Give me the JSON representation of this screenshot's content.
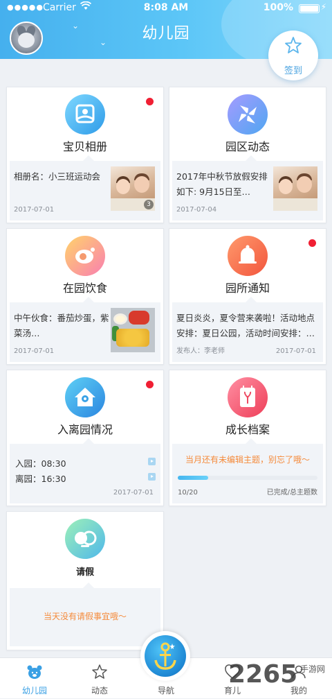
{
  "status_bar": {
    "signal": "●●●●●",
    "carrier": "Carrier",
    "time": "8:08 AM",
    "battery": "100%"
  },
  "header": {
    "title": "幼儿园",
    "signin_label": "签到"
  },
  "cards": {
    "album": {
      "title": "宝贝相册",
      "text": "相册名：小三班运动会",
      "date": "2017-07-01",
      "photo_count": "3",
      "has_new": true
    },
    "news": {
      "title": "园区动态",
      "text": "2017年中秋节放假安排如下: 9月15日至…",
      "date": "2017-07-04",
      "has_new": false
    },
    "meals": {
      "title": "在园饮食",
      "text": "中午伙食：番茄炒蛋，紫菜汤…",
      "date": "2017-07-01",
      "has_new": false
    },
    "notice": {
      "title": "园所通知",
      "text": "夏日炎炎，夏令营来袭啦！活动地点安排：夏日公园，活动时间安排：…",
      "author": "发布人：李老师",
      "date": "2017-07-01",
      "has_new": true
    },
    "attendance": {
      "title": "入离园情况",
      "in_label": "入园：08:30",
      "out_label": "离园：16:30",
      "date": "2017-07-01",
      "has_new": true
    },
    "growth": {
      "title": "成长档案",
      "reminder": "当月还有未编辑主题，别忘了哦～",
      "progress_text": "10/20",
      "progress_value": 0.22,
      "progress_label": "已完成/总主题数"
    },
    "leave": {
      "title": "请假",
      "text": "当天没有请假事宜哦～"
    }
  },
  "tabbar": {
    "tabs": [
      "幼儿园",
      "动态",
      "导航",
      "育儿",
      "我的"
    ],
    "active_index": 0
  },
  "watermark": {
    "big": "2265",
    "small": "手游网"
  },
  "colors": {
    "accent": "#3aa0e4",
    "alert_dot": "#f01f33",
    "reminder": "#f58a3a"
  }
}
